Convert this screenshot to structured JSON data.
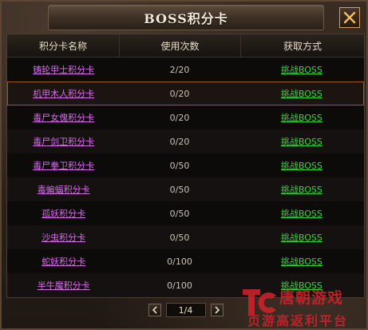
{
  "window": {
    "title": "BOSS积分卡"
  },
  "table": {
    "headers": [
      "积分卡名称",
      "使用次数",
      "获取方式"
    ],
    "rows": [
      {
        "name": "铸轮甲士积分卡",
        "count": "2/20",
        "source": "挑战BOSS"
      },
      {
        "name": "机甲木人积分卡",
        "count": "0/20",
        "source": "挑战BOSS"
      },
      {
        "name": "毒尸女傀积分卡",
        "count": "0/20",
        "source": "挑战BOSS"
      },
      {
        "name": "毒尸剑卫积分卡",
        "count": "0/20",
        "source": "挑战BOSS"
      },
      {
        "name": "毒尸拳卫积分卡",
        "count": "0/50",
        "source": "挑战BOSS"
      },
      {
        "name": "毒蝙蝠积分卡",
        "count": "0/50",
        "source": "挑战BOSS"
      },
      {
        "name": "孤妖积分卡",
        "count": "0/50",
        "source": "挑战BOSS"
      },
      {
        "name": "沙虫积分卡",
        "count": "0/50",
        "source": "挑战BOSS"
      },
      {
        "name": "蛇妖积分卡",
        "count": "0/100",
        "source": "挑战BOSS"
      },
      {
        "name": "半牛魔积分卡",
        "count": "0/100",
        "source": "挑战BOSS"
      }
    ],
    "selected_row": 1
  },
  "pager": {
    "page_text": "1/4"
  },
  "watermark": {
    "line1": "唐朝游戏",
    "line2": "页游高返利平台"
  },
  "colors": {
    "name_link": "#d66be8",
    "source_link": "#3ed43e",
    "selected_border": "#9b5a1c",
    "watermark": "#c8232c"
  },
  "icons": {
    "close": "close-x-icon",
    "prev": "chevron-left-icon",
    "next": "chevron-right-icon"
  }
}
